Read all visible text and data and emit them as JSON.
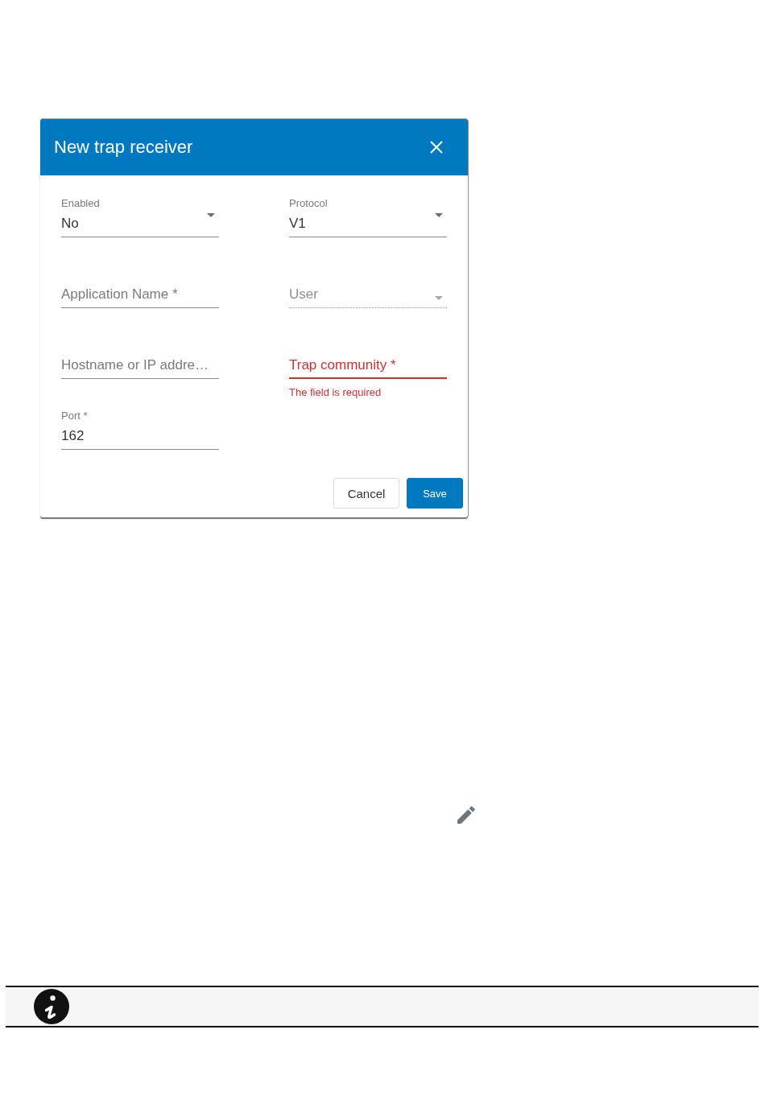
{
  "dialog": {
    "title": "New trap receiver",
    "fields": [
      {
        "kind": "select",
        "label": "Enabled",
        "value": "No",
        "disabled": false,
        "invalid": false
      },
      {
        "kind": "select",
        "label": "Protocol",
        "value": "V1",
        "disabled": false,
        "invalid": false
      },
      {
        "kind": "text",
        "placeholder": "Application Name *",
        "disabled": false,
        "invalid": false
      },
      {
        "kind": "select",
        "placeholder": "User",
        "disabled": true,
        "invalid": false
      },
      {
        "kind": "text",
        "placeholder": "Hostname or IP addre…",
        "disabled": false,
        "invalid": false
      },
      {
        "kind": "text",
        "placeholder": "Trap community *",
        "disabled": false,
        "invalid": true,
        "error": "The field is required"
      },
      {
        "kind": "text",
        "label": "Port *",
        "value": "162",
        "disabled": false,
        "invalid": false
      }
    ],
    "buttons": [
      {
        "kind": "secondary",
        "label": "Cancel"
      },
      {
        "kind": "primary",
        "label": "Save"
      }
    ]
  }
}
